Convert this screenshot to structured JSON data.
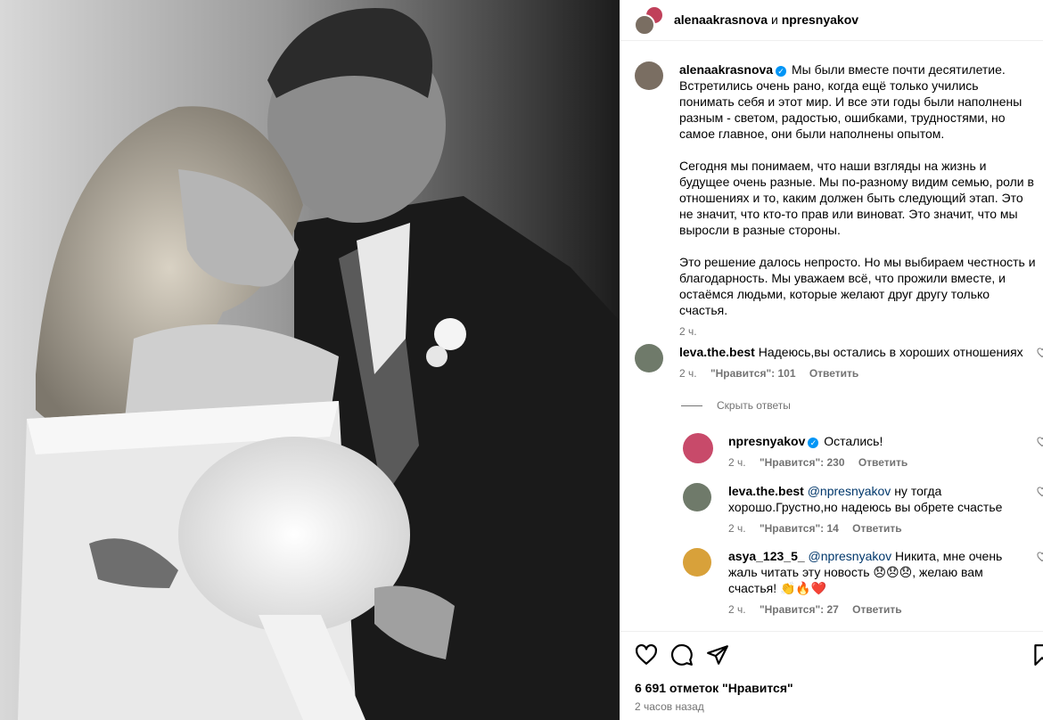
{
  "post": {
    "header_user_1": "alenaakrasnova",
    "header_conjunction": "и",
    "header_user_2": "npresnyakov"
  },
  "caption": {
    "user": "alenaakrasnova",
    "paragraph_1": "Мы были вместе почти десятилетие. Встретились очень рано, когда ещё только учились понимать себя и этот мир. И все эти годы были наполнены разным - светом, радостью, ошибками, трудностями, но самое главное, они были наполнены опытом.",
    "paragraph_2": "Сегодня мы понимаем, что наши взгляды на жизнь и будущее очень разные. Мы по-разному видим семью, роли в отношениях и то, каким должен быть следующий этап. Это не значит, что кто-то прав или виноват. Это значит, что мы выросли в разные стороны.",
    "paragraph_3": "Это решение далось непросто. Но мы выбираем честность и благодарность. Мы уважаем всё, что прожили вместе, и остаёмся людьми, которые желают друг другу только счастья.",
    "time": "2 ч."
  },
  "comments": [
    {
      "user": "leva.the.best",
      "text": "Надеюсь,вы остались в хороших отношениях",
      "time": "2 ч.",
      "likes": "\"Нравится\": 101",
      "reply": "Ответить"
    }
  ],
  "hide_replies": "Скрыть ответы",
  "replies": [
    {
      "user": "npresnyakov",
      "text": "Остались!",
      "time": "2 ч.",
      "likes": "\"Нравится\": 230",
      "reply": "Ответить"
    },
    {
      "user": "leva.the.best",
      "mention": "@npresnyakov",
      "text": "ну тогда хорошо.Грустно,но надеюсь вы обрете счастье",
      "time": "2 ч.",
      "likes": "\"Нравится\": 14",
      "reply": "Ответить"
    },
    {
      "user": "asya_123_5_",
      "mention": "@npresnyakov",
      "text": "Никита, мне очень жаль читать эту новость 😞😞😞, желаю вам счастья! 👏🔥❤️",
      "time": "2 ч.",
      "likes": "\"Нравится\": 27",
      "reply": "Ответить"
    }
  ],
  "footer": {
    "likes": "6 691 отметок \"Нравится\"",
    "posted": "2 часов назад"
  },
  "colors": {
    "verified": "#0095f6",
    "meta": "#737373",
    "mention": "#00376b"
  },
  "icons": [
    "heart-icon",
    "comment-icon",
    "share-icon",
    "bookmark-icon",
    "verified-icon"
  ]
}
